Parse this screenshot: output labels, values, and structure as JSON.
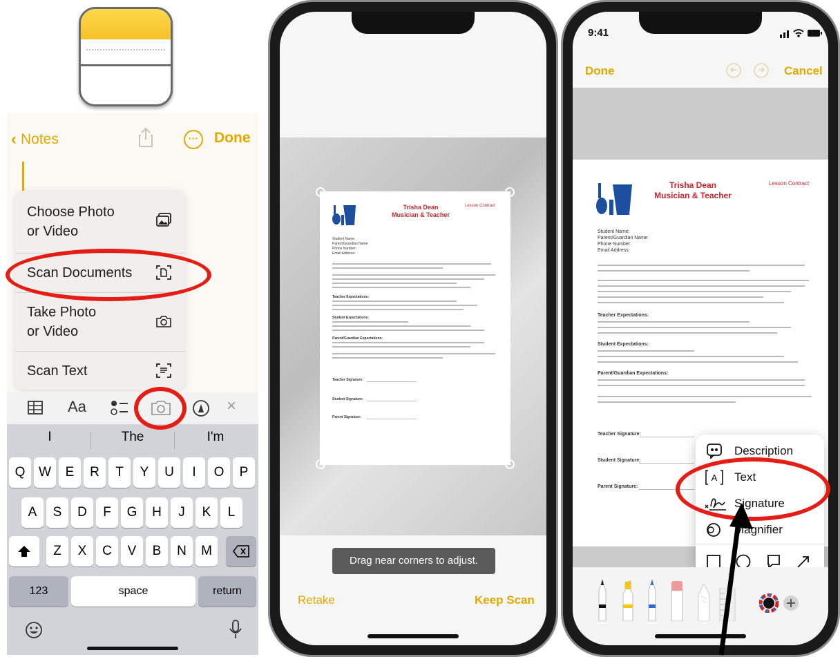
{
  "panel1": {
    "nav": {
      "back_label": "Notes",
      "done_label": "Done"
    },
    "menu": [
      {
        "label_line1": "Choose Photo",
        "label_line2": "or Video",
        "icon": "photo-icon"
      },
      {
        "label_line1": "Scan Documents",
        "label_line2": "",
        "icon": "scan-document-icon"
      },
      {
        "label_line1": "Take Photo",
        "label_line2": "or Video",
        "icon": "camera-icon"
      },
      {
        "label_line1": "Scan Text",
        "label_line2": "",
        "icon": "scan-text-icon"
      }
    ],
    "toolbar": {
      "format_label": "Aa"
    },
    "keyboard": {
      "suggestions": [
        "I",
        "The",
        "I'm"
      ],
      "row1": [
        "Q",
        "W",
        "E",
        "R",
        "T",
        "Y",
        "U",
        "I",
        "O",
        "P"
      ],
      "row2": [
        "A",
        "S",
        "D",
        "F",
        "G",
        "H",
        "J",
        "K",
        "L"
      ],
      "row3": [
        "Z",
        "X",
        "C",
        "V",
        "B",
        "N",
        "M"
      ],
      "numbers_label": "123",
      "space_label": "space",
      "return_label": "return"
    }
  },
  "panel2": {
    "hint": "Drag near corners to adjust.",
    "retake_label": "Retake",
    "keep_label": "Keep Scan"
  },
  "panel3": {
    "status_time": "9:41",
    "done_label": "Done",
    "cancel_label": "Cancel",
    "popover": [
      "Description",
      "Text",
      "Signature",
      "Magnifier"
    ]
  },
  "document": {
    "name_line1": "Trisha Dean",
    "name_line2": "Musician & Teacher",
    "doc_label": "Lesson Contract",
    "fields": [
      "Student Name:",
      "Parent/Guardian Name:",
      "Phone Number:",
      "Email Address:"
    ],
    "sections": [
      "Teacher Expectations:",
      "Student Expectations:",
      "Parent/Guardian Expectations:"
    ],
    "signatures": [
      "Teacher Signature:",
      "Student Signature:",
      "Parent Signature:"
    ]
  },
  "colors": {
    "accent": "#e1a900",
    "annotation": "#e41e16",
    "doc_red": "#c8252c",
    "doc_blue": "#1d4fa0"
  }
}
